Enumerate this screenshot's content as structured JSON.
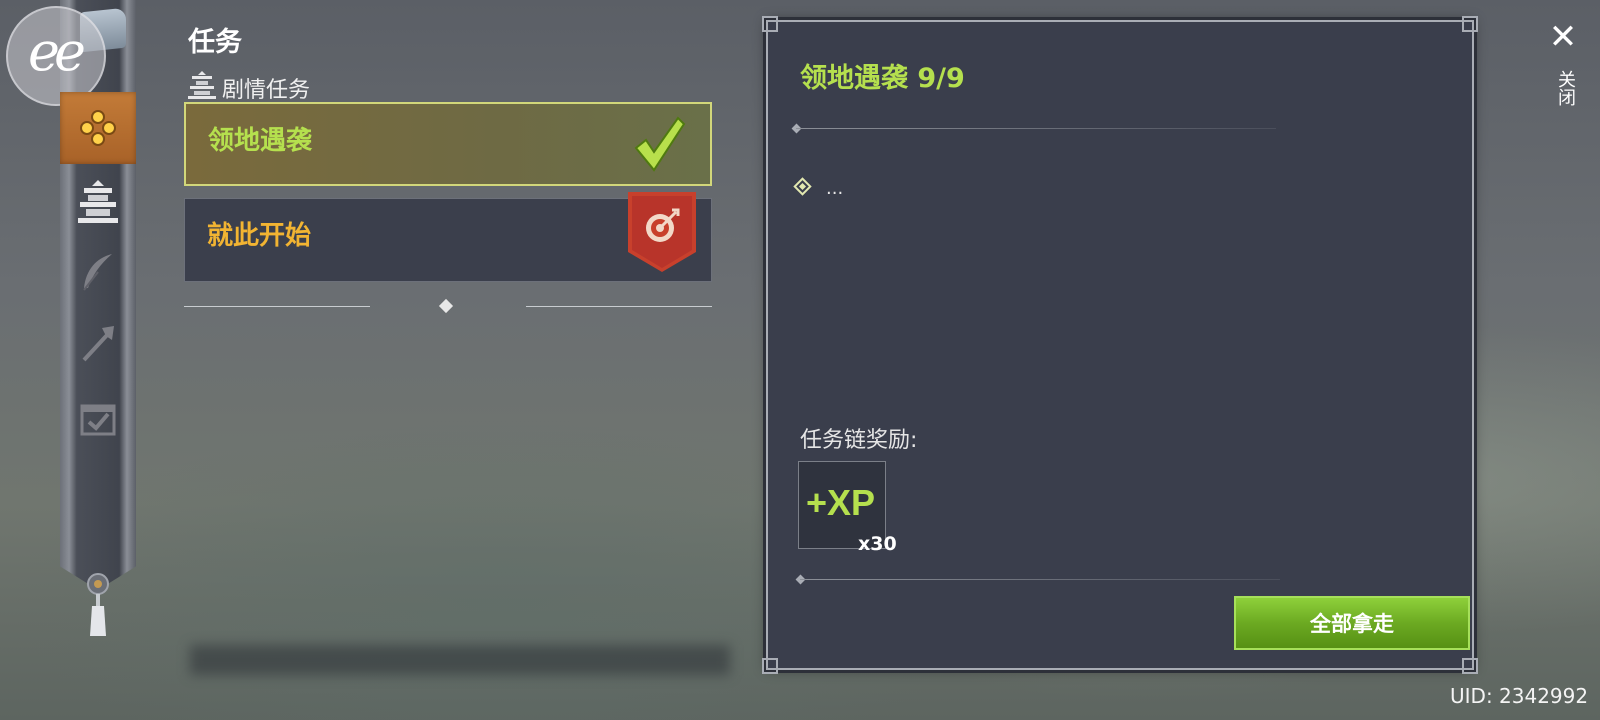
{
  "header": {
    "title": "任务"
  },
  "category": {
    "label": "剧情任务",
    "icon": "pagoda-icon"
  },
  "quests": [
    {
      "label": "领地遇袭",
      "status": "completed",
      "color": "#b5e04e"
    },
    {
      "label": "就此开始",
      "status": "tracked",
      "color": "#f2b432"
    }
  ],
  "sidebar": {
    "avatar_text": "ee",
    "items": [
      {
        "icon": "quest-icon",
        "active": true
      },
      {
        "icon": "pagoda-icon",
        "active": false
      },
      {
        "icon": "feather-icon",
        "active": false
      },
      {
        "icon": "axe-icon",
        "active": false
      },
      {
        "icon": "calendar-check-icon",
        "active": false
      }
    ]
  },
  "detail": {
    "title": "领地遇袭 9/9",
    "objective": "...",
    "reward_label": "任务链奖励:",
    "reward": {
      "icon_text": "+XP",
      "quantity": "x30"
    },
    "claim_button": "全部拿走"
  },
  "close": {
    "symbol": "✕",
    "label": "关闭"
  },
  "uid": "UID: 2342992",
  "colors": {
    "accent_green": "#b5e04e",
    "accent_orange": "#f2b432",
    "panel": "#3a3e4c"
  }
}
